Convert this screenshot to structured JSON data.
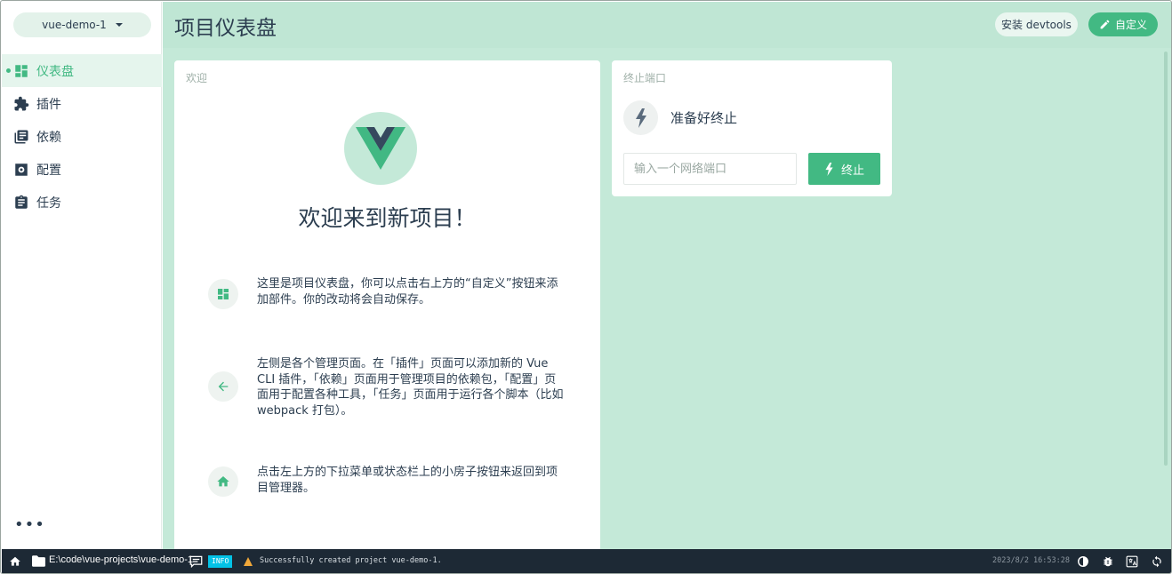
{
  "sidebar": {
    "project_name": "vue-demo-1",
    "items": [
      {
        "label": "仪表盘",
        "icon": "dashboard-icon",
        "active": true
      },
      {
        "label": "插件",
        "icon": "puzzle-icon"
      },
      {
        "label": "依赖",
        "icon": "library-books-icon"
      },
      {
        "label": "配置",
        "icon": "settings-icon"
      },
      {
        "label": "任务",
        "icon": "clipboard-icon"
      }
    ],
    "more_label": "•••"
  },
  "header": {
    "title": "项目仪表盘",
    "devtools_label": "安装 devtools",
    "customize_label": "自定义"
  },
  "welcome": {
    "card_title": "欢迎",
    "heading": "欢迎来到新项目！",
    "tips": [
      {
        "icon": "dashboard-icon",
        "text": "这里是项目仪表盘，你可以点击右上方的“自定义”按钮来添加部件。你的改动将会自动保存。"
      },
      {
        "icon": "arrow-left-icon",
        "text": "左侧是各个管理页面。在「插件」页面可以添加新的 Vue CLI 插件，「依赖」页面用于管理项目的依赖包，「配置」页面用于配置各种工具，「任务」页面用于运行各个脚本（比如 webpack 打包）。"
      },
      {
        "icon": "home-icon",
        "text": "点击左上方的下拉菜单或状态栏上的小房子按钮来返回到项目管理器。"
      }
    ]
  },
  "kill_port": {
    "card_title": "终止端口",
    "status": "准备好终止",
    "input_placeholder": "输入一个网络端口",
    "input_value": "",
    "button_label": "终止"
  },
  "statusbar": {
    "path": "E:\\code\\vue-projects\\vue-demo-1",
    "log_level": "INFO",
    "message": "Successfully created project vue-demo-1.",
    "timestamp": "2023/8/2 16:53:28"
  },
  "colors": {
    "accent": "#42b983",
    "main_bg": "#c4e9d8",
    "statusbar_bg": "#1d2935",
    "info_badge": "#03c2e6"
  }
}
